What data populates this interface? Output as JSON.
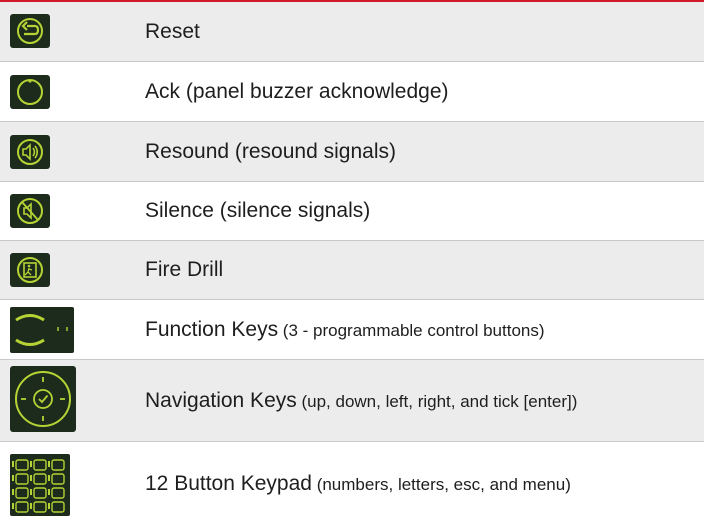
{
  "rows": [
    {
      "label": "Reset",
      "detail": "",
      "icon": "reset-icon"
    },
    {
      "label": "Ack (panel buzzer acknowledge)",
      "detail": "",
      "icon": "ack-icon"
    },
    {
      "label": "Resound (resound signals)",
      "detail": "",
      "icon": "resound-icon"
    },
    {
      "label": "Silence (silence signals)",
      "detail": "",
      "icon": "silence-icon"
    },
    {
      "label": "Fire Drill",
      "detail": "",
      "icon": "fire-drill-icon"
    },
    {
      "label": "Function Keys",
      "detail": " (3 - programmable control buttons)",
      "icon": "function-keys-icon"
    },
    {
      "label": "Navigation Keys",
      "detail": " (up, down, left, right, and tick [enter])",
      "icon": "navigation-keys-icon"
    },
    {
      "label": "12 Button Keypad",
      "detail": " (numbers, letters, esc, and menu)",
      "icon": "keypad-icon"
    }
  ],
  "colors": {
    "icon_bg": "#1d2b1d",
    "icon_fg": "#b5d334",
    "accent_line": "#d3182a",
    "row_shade": "#ececec"
  }
}
